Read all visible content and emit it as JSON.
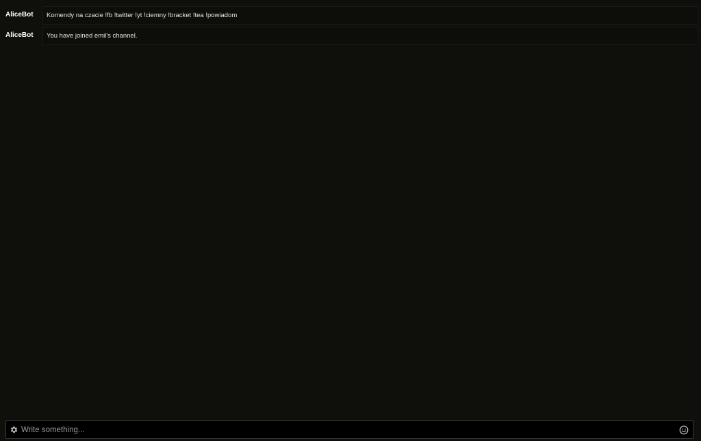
{
  "messages": [
    {
      "author": "AliceBot",
      "text": "Komendy na czacie !fb !twitter !yt !ciemny !bracket !tea !powiadom"
    },
    {
      "author": "AliceBot",
      "text": "You have joined emil's channel."
    }
  ],
  "composer": {
    "placeholder": "Write something...",
    "value": "",
    "settings_icon": "gear-icon",
    "emoji_icon": "smiley-icon"
  },
  "colors": {
    "background": "#0f0f0c",
    "author": "#ffffff",
    "message_text": "#e6e6e6",
    "input_border": "#3a3a36"
  }
}
